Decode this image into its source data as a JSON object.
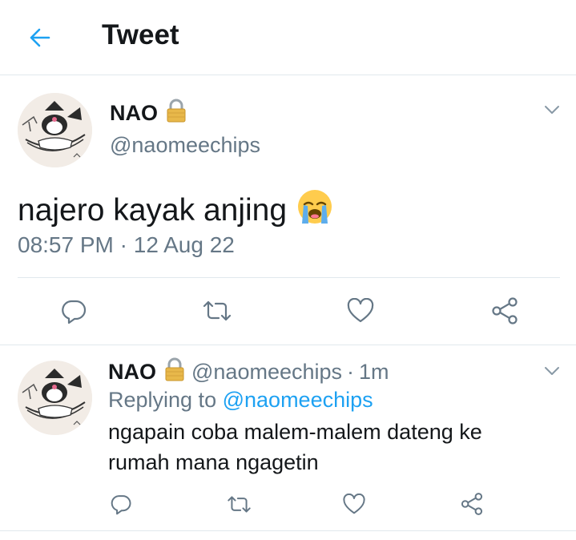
{
  "header": {
    "title": "Tweet",
    "back_icon": "arrow-left-icon"
  },
  "colors": {
    "accent": "#1da1f2",
    "text": "#14171a",
    "muted": "#657786",
    "divider": "#e1e8ed"
  },
  "main_tweet": {
    "display_name": "NAO",
    "handle": "@naomeechips",
    "text": "najero kayak anjing",
    "emoji": "loudly-crying-face",
    "time": "08:57 PM",
    "separator": "·",
    "date": "12 Aug 22"
  },
  "reply_tweet": {
    "display_name": "NAO",
    "handle": "@naomeechips",
    "separator": "·",
    "age": "1m",
    "replying_prefix": "Replying to",
    "replying_handle": "@naomeechips",
    "text": "ngapain coba malem-malem dateng ke rumah mana ngagetin"
  },
  "actions": [
    "reply-icon",
    "retweet-icon",
    "like-icon",
    "share-icon"
  ]
}
